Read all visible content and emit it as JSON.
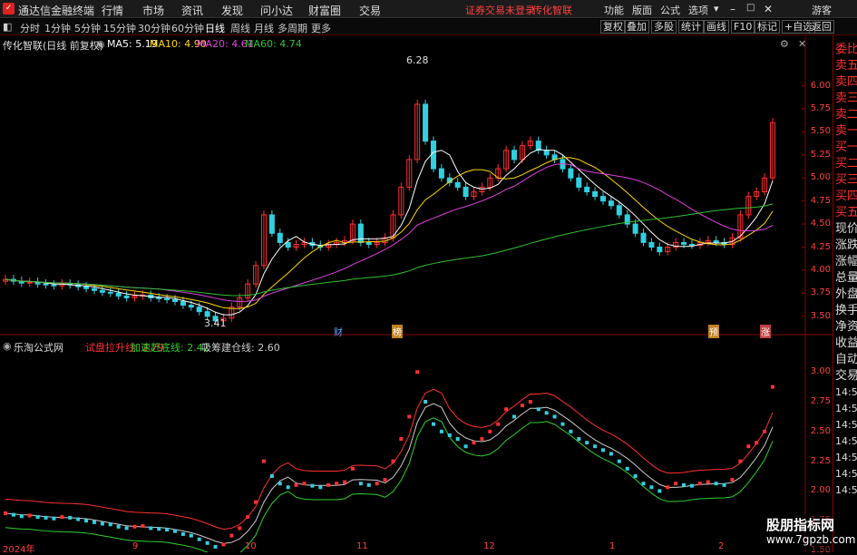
{
  "titlebar": {
    "app": "通达信金融终端",
    "menus": [
      "行情",
      "市场",
      "资讯",
      "发现",
      "问小达",
      "财富圈",
      "交易"
    ],
    "warning": "证券交易未登录",
    "stock": "传化智联",
    "right": [
      "功能",
      "版面",
      "公式",
      "选项"
    ],
    "guest": "游客"
  },
  "toolbar": {
    "periods": [
      "分时",
      "1分钟",
      "5分钟",
      "15分钟",
      "30分钟",
      "60分钟",
      "日线",
      "周线",
      "月线",
      "多周期",
      "更多"
    ],
    "active": "日线",
    "buttons": [
      "复权",
      "叠加",
      "多股",
      "统计",
      "画线",
      "F10",
      "标记",
      "+自选",
      "返回"
    ]
  },
  "main_header": {
    "title": "传化智联(日线 前复权)",
    "ma": [
      {
        "label": "MA5: 5.19",
        "color": "#ffffff"
      },
      {
        "label": "MA10: 4.90",
        "color": "#ffd700"
      },
      {
        "label": "MA20: 4.61",
        "color": "#e040e0"
      },
      {
        "label": "MA60: 4.74",
        "color": "#30c030"
      }
    ]
  },
  "sub_header": {
    "title": "乐淘公式网",
    "items": [
      {
        "label": "试盘拉升线: 2.79",
        "color": "#ff3030"
      },
      {
        "label": "加速赶底线: 2.42",
        "color": "#30d030"
      },
      {
        "label": "吸筹建仓线: 2.60",
        "color": "#cccccc"
      }
    ]
  },
  "annotations": {
    "high": "6.28",
    "low": "3.41"
  },
  "events": [
    {
      "label": "财",
      "color": "#3060c0"
    },
    {
      "label": "榜",
      "color": "#c08020"
    },
    {
      "label": "预",
      "color": "#c08020"
    },
    {
      "label": "涨",
      "color": "#c04040"
    }
  ],
  "sidebar": [
    "委比",
    "卖五",
    "卖四",
    "卖三",
    "卖二",
    "卖一",
    "买一",
    "买二",
    "买三",
    "买四",
    "买五",
    "现价",
    "涨跌",
    "涨幅",
    "总量",
    "外盘",
    "换手",
    "净资",
    "收益",
    "自动",
    "交易",
    "14:56",
    "14:56",
    "14:56",
    "14:56",
    "14:56",
    "14:56",
    "14:56"
  ],
  "x_axis": [
    "2024年",
    "9",
    "10",
    "11",
    "12",
    "1",
    "2"
  ],
  "chart_data": [
    {
      "type": "candlestick",
      "title": "传化智联(日线 前复权)",
      "y_axis": [
        3.5,
        3.75,
        4.0,
        4.25,
        4.5,
        4.75,
        5.0,
        5.25,
        5.5,
        5.75,
        6.0
      ],
      "ylim": [
        3.35,
        6.35
      ],
      "close": [
        3.9,
        3.88,
        3.86,
        3.87,
        3.85,
        3.84,
        3.83,
        3.85,
        3.84,
        3.82,
        3.8,
        3.78,
        3.76,
        3.75,
        3.72,
        3.7,
        3.72,
        3.73,
        3.7,
        3.69,
        3.68,
        3.66,
        3.62,
        3.6,
        3.55,
        3.5,
        3.45,
        3.48,
        3.6,
        3.7,
        3.85,
        4.05,
        4.6,
        4.4,
        4.3,
        4.25,
        4.28,
        4.3,
        4.27,
        4.25,
        4.28,
        4.3,
        4.32,
        4.5,
        4.3,
        4.28,
        4.3,
        4.35,
        4.6,
        4.9,
        5.2,
        5.8,
        5.4,
        5.1,
        5.0,
        4.95,
        4.9,
        4.8,
        4.85,
        4.9,
        5.0,
        5.1,
        5.3,
        5.2,
        5.35,
        5.4,
        5.3,
        5.25,
        5.2,
        5.1,
        5.0,
        4.9,
        4.85,
        4.8,
        4.75,
        4.7,
        4.6,
        4.5,
        4.4,
        4.3,
        4.25,
        4.2,
        4.25,
        4.3,
        4.28,
        4.27,
        4.3,
        4.32,
        4.3,
        4.28,
        4.35,
        4.6,
        4.8,
        4.85,
        5.0,
        5.6
      ],
      "series": [
        {
          "name": "MA5",
          "last": 5.19
        },
        {
          "name": "MA10",
          "last": 4.9
        },
        {
          "name": "MA20",
          "last": 4.61
        },
        {
          "name": "MA60",
          "last": 4.74
        }
      ],
      "high": 6.28,
      "low": 3.41
    },
    {
      "type": "line",
      "title": "乐淘公式网",
      "y_axis": [
        1.5,
        1.75,
        2.0,
        2.25,
        2.5,
        2.75,
        3.0
      ],
      "ylim": [
        1.5,
        3.2
      ],
      "series": [
        {
          "name": "试盘拉升线",
          "last": 2.79
        },
        {
          "name": "加速赶底线",
          "last": 2.42
        },
        {
          "name": "吸筹建仓线",
          "last": 2.6
        }
      ]
    }
  ]
}
